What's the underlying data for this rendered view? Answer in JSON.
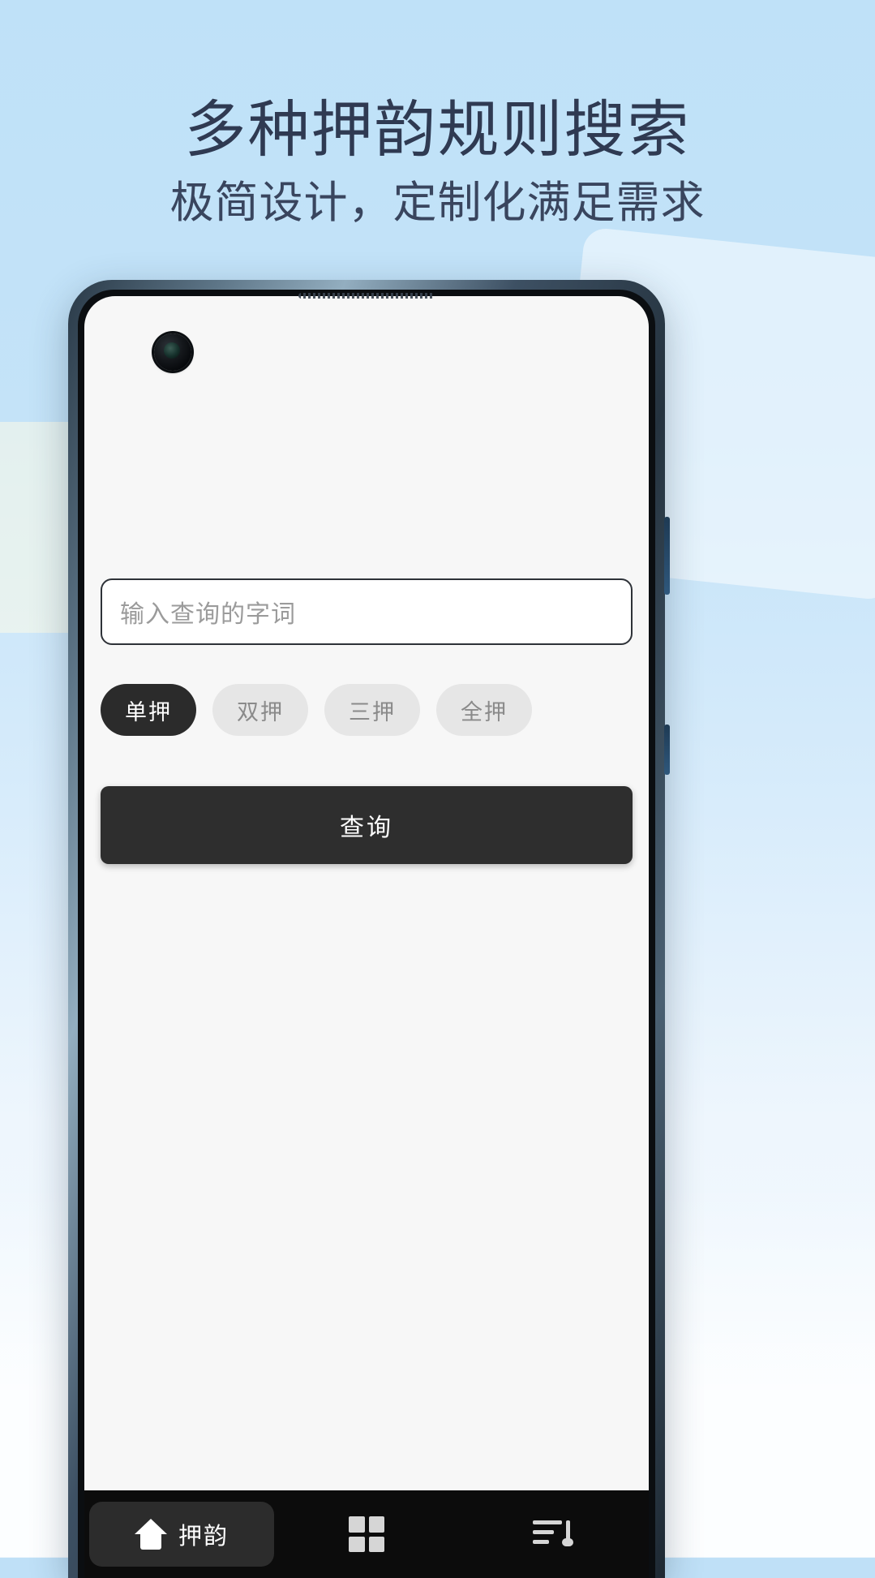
{
  "promo": {
    "title": "多种押韵规则搜索",
    "subtitle": "极简设计，定制化满足需求",
    "title_color": "#2f3a52",
    "background_color": "#bfe1f8"
  },
  "phone": {
    "frame_color": "#3d5063",
    "screen_background": "#f7f7f7",
    "camera_icon": "front-camera-punch-hole",
    "speaker_icon": "earpiece-speaker-grille"
  },
  "app": {
    "search": {
      "placeholder": "输入查询的字词",
      "value": ""
    },
    "rhyme_modes": [
      {
        "label": "单押",
        "active": true
      },
      {
        "label": "双押",
        "active": false
      },
      {
        "label": "三押",
        "active": false
      },
      {
        "label": "全押",
        "active": false
      }
    ],
    "query_button": {
      "label": "查询",
      "color": "#2e2e2e",
      "text_color": "#ffffff"
    },
    "bottom_nav": [
      {
        "label": "押韵",
        "icon": "home-icon",
        "active": true
      },
      {
        "label": "",
        "icon": "grid-icon",
        "active": false
      },
      {
        "label": "",
        "icon": "playlist-music-icon",
        "active": false
      }
    ]
  }
}
